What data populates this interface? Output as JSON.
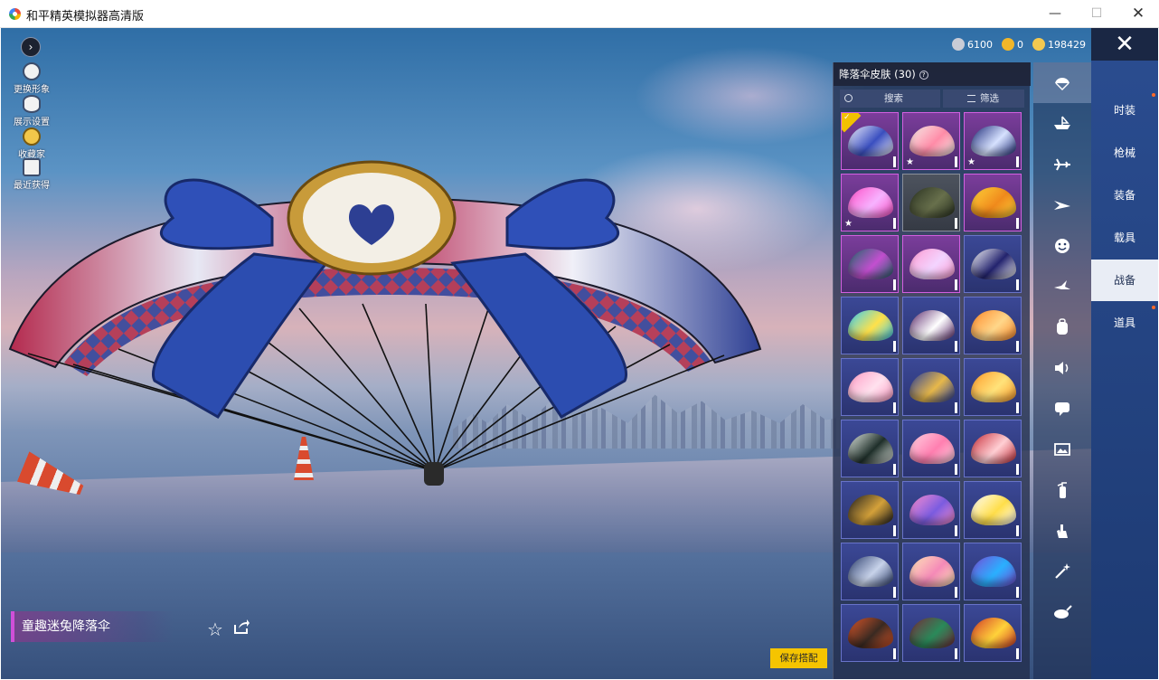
{
  "window": {
    "title": "和平精英模拟器高清版",
    "min_label": "—",
    "max_label": "☐",
    "close_label": "✕"
  },
  "left_menu": {
    "expand_label": "›",
    "items": [
      {
        "label": "更换形象",
        "icon": "avatar-icon"
      },
      {
        "label": "展示设置",
        "icon": "eye-icon"
      },
      {
        "label": "收藏家",
        "icon": "collector-badge-icon"
      },
      {
        "label": "最近获得",
        "icon": "gift-icon"
      }
    ]
  },
  "currency": [
    {
      "icon": "coupon-icon",
      "value": "6100",
      "color": "#c9ccd6"
    },
    {
      "icon": "gold-coin-icon",
      "value": "0",
      "color": "#f1b629"
    },
    {
      "icon": "bonus-coin-icon",
      "value": "198429",
      "color": "#f4c950"
    }
  ],
  "close_panel_label": "✕",
  "skin_panel": {
    "title": "降落伞皮肤 (30)",
    "help_label": "?",
    "search_label": "搜索",
    "filter_label": "筛选",
    "skins": [
      {
        "rarity": "pink",
        "colors": [
          "#f4f4ff",
          "#3a4fc0"
        ],
        "equipped": true,
        "starred": false
      },
      {
        "rarity": "pink",
        "colors": [
          "#f6f0ea",
          "#ff8ca8"
        ],
        "equipped": false,
        "starred": true
      },
      {
        "rarity": "pink",
        "colors": [
          "#1d2b7a",
          "#d7e2ff"
        ],
        "equipped": false,
        "starred": true
      },
      {
        "rarity": "pink",
        "colors": [
          "#ff4fc8",
          "#f7b3ff"
        ],
        "equipped": false,
        "starred": true
      },
      {
        "rarity": "gray",
        "colors": [
          "#2b3322",
          "#68704c"
        ],
        "equipped": false,
        "starred": false
      },
      {
        "rarity": "pink",
        "colors": [
          "#ffd43a",
          "#f08a1c"
        ],
        "equipped": false,
        "starred": false
      },
      {
        "rarity": "pink",
        "colors": [
          "#1f6a6a",
          "#c34fd0"
        ],
        "equipped": false,
        "starred": false
      },
      {
        "rarity": "pink",
        "colors": [
          "#ff9bd2",
          "#f3d4ff"
        ],
        "equipped": false,
        "starred": false
      },
      {
        "rarity": "blue",
        "colors": [
          "#ffffff",
          "#23236e"
        ],
        "equipped": false,
        "starred": false
      },
      {
        "rarity": "blue",
        "colors": [
          "#33d0ff",
          "#ffe14a"
        ],
        "equipped": false,
        "starred": false
      },
      {
        "rarity": "blue",
        "colors": [
          "#5d2a6e",
          "#ffffff"
        ],
        "equipped": false,
        "starred": false
      },
      {
        "rarity": "blue",
        "colors": [
          "#ff8a2a",
          "#ffd78a"
        ],
        "equipped": false,
        "starred": false
      },
      {
        "rarity": "blue",
        "colors": [
          "#ff9cc5",
          "#ffe1ee"
        ],
        "equipped": false,
        "starred": false
      },
      {
        "rarity": "blue",
        "colors": [
          "#283e9e",
          "#e7b84a"
        ],
        "equipped": false,
        "starred": false
      },
      {
        "rarity": "blue",
        "colors": [
          "#ff9b2a",
          "#ffe27a"
        ],
        "equipped": false,
        "starred": false
      },
      {
        "rarity": "blue",
        "colors": [
          "#e8efe8",
          "#1f2f2a"
        ],
        "equipped": false,
        "starred": false
      },
      {
        "rarity": "blue",
        "colors": [
          "#ffd5e4",
          "#ff7fb0"
        ],
        "equipped": false,
        "starred": false
      },
      {
        "rarity": "blue",
        "colors": [
          "#c92e3a",
          "#ffcfd4"
        ],
        "equipped": false,
        "starred": false
      },
      {
        "rarity": "blue",
        "colors": [
          "#1f1f1f",
          "#d4a13a"
        ],
        "equipped": false,
        "starred": false
      },
      {
        "rarity": "blue",
        "colors": [
          "#ff8fd0",
          "#7b5ce0"
        ],
        "equipped": false,
        "starred": false
      },
      {
        "rarity": "blue",
        "colors": [
          "#ffffff",
          "#ffde4a"
        ],
        "equipped": false,
        "starred": false
      },
      {
        "rarity": "blue",
        "colors": [
          "#2c3e6e",
          "#c8d3ea"
        ],
        "equipped": false,
        "starred": false
      },
      {
        "rarity": "blue",
        "colors": [
          "#ffe9b8",
          "#f58ab8"
        ],
        "equipped": false,
        "starred": false
      },
      {
        "rarity": "blue",
        "colors": [
          "#7a4cd8",
          "#2ab0ff"
        ],
        "equipped": false,
        "starred": false
      },
      {
        "rarity": "blue",
        "colors": [
          "#e0582a",
          "#3a2a22"
        ],
        "equipped": false,
        "starred": false
      },
      {
        "rarity": "blue",
        "colors": [
          "#7a2a3a",
          "#2a8a5a"
        ],
        "equipped": false,
        "starred": false
      },
      {
        "rarity": "blue",
        "colors": [
          "#d43a2a",
          "#ffd23a"
        ],
        "equipped": false,
        "starred": false
      }
    ]
  },
  "categories": [
    {
      "icon": "parachute-icon",
      "active": true
    },
    {
      "icon": "boat-icon",
      "active": false
    },
    {
      "icon": "plane-icon",
      "active": false
    },
    {
      "icon": "glider-icon",
      "active": false
    },
    {
      "icon": "emote-icon",
      "active": false
    },
    {
      "icon": "bird-icon",
      "active": false
    },
    {
      "icon": "backpack-icon",
      "active": false
    },
    {
      "icon": "speaker-icon",
      "active": false
    },
    {
      "icon": "chat-bubble-icon",
      "active": false
    },
    {
      "icon": "picture-frame-icon",
      "active": false
    },
    {
      "icon": "fire-extinguisher-icon",
      "active": false
    },
    {
      "icon": "hand-gesture-icon",
      "active": false
    },
    {
      "icon": "magic-wand-icon",
      "active": false
    },
    {
      "icon": "pan-icon",
      "active": false
    }
  ],
  "tabs": [
    {
      "label": "时装",
      "active": false,
      "dot": true
    },
    {
      "label": "枪械",
      "active": false,
      "dot": false
    },
    {
      "label": "装备",
      "active": false,
      "dot": false
    },
    {
      "label": "载具",
      "active": false,
      "dot": false
    },
    {
      "label": "战备",
      "active": true,
      "dot": false
    },
    {
      "label": "道具",
      "active": false,
      "dot": true
    }
  ],
  "selected_item_name": "童趣迷兔降落伞",
  "save_label": "保存搭配",
  "colors": {
    "accent_yellow": "#f5c400",
    "tab_blue": "#2a4c8f",
    "rarity_pink": "#d25fe0",
    "rarity_blue": "#6873c9"
  }
}
